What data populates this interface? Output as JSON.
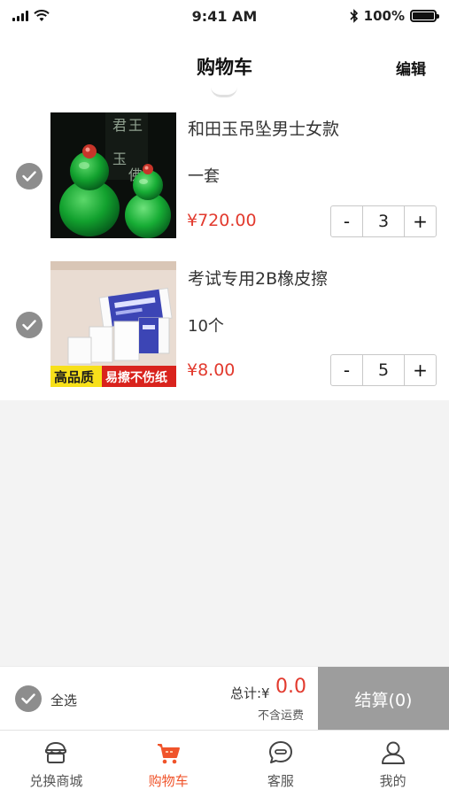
{
  "status_bar": {
    "time": "9:41 AM",
    "battery": "100%"
  },
  "header": {
    "title": "购物车",
    "edit_label": "编辑"
  },
  "cart": {
    "items": [
      {
        "name": "和田玉吊坠男士女款",
        "spec": "一套",
        "price": "¥720.00",
        "quantity": "3",
        "decrement": "-",
        "increment": "+",
        "selected": true
      },
      {
        "name": "考试专用2B橡皮擦",
        "spec": "10个",
        "price": "¥8.00",
        "quantity": "5",
        "decrement": "-",
        "increment": "+",
        "selected": true
      }
    ],
    "eraser_image_text": {
      "left": "高品质",
      "right": "易擦不伤纸"
    }
  },
  "checkout": {
    "select_all_label": "全选",
    "total_label": "总计:¥",
    "total_value": "0.0",
    "freight_note": "不含运费",
    "settle_label": "结算(0)"
  },
  "tabs": [
    {
      "label": "兑换商城",
      "icon": "shop-icon",
      "active": false
    },
    {
      "label": "购物车",
      "icon": "cart-icon",
      "active": true
    },
    {
      "label": "客服",
      "icon": "chat-icon",
      "active": false
    },
    {
      "label": "我的",
      "icon": "user-icon",
      "active": false
    }
  ],
  "colors": {
    "price": "#e23a2e",
    "active_tab": "#f0542b",
    "settle_button": "#9d9d9d",
    "check": "#8d8d8d"
  }
}
